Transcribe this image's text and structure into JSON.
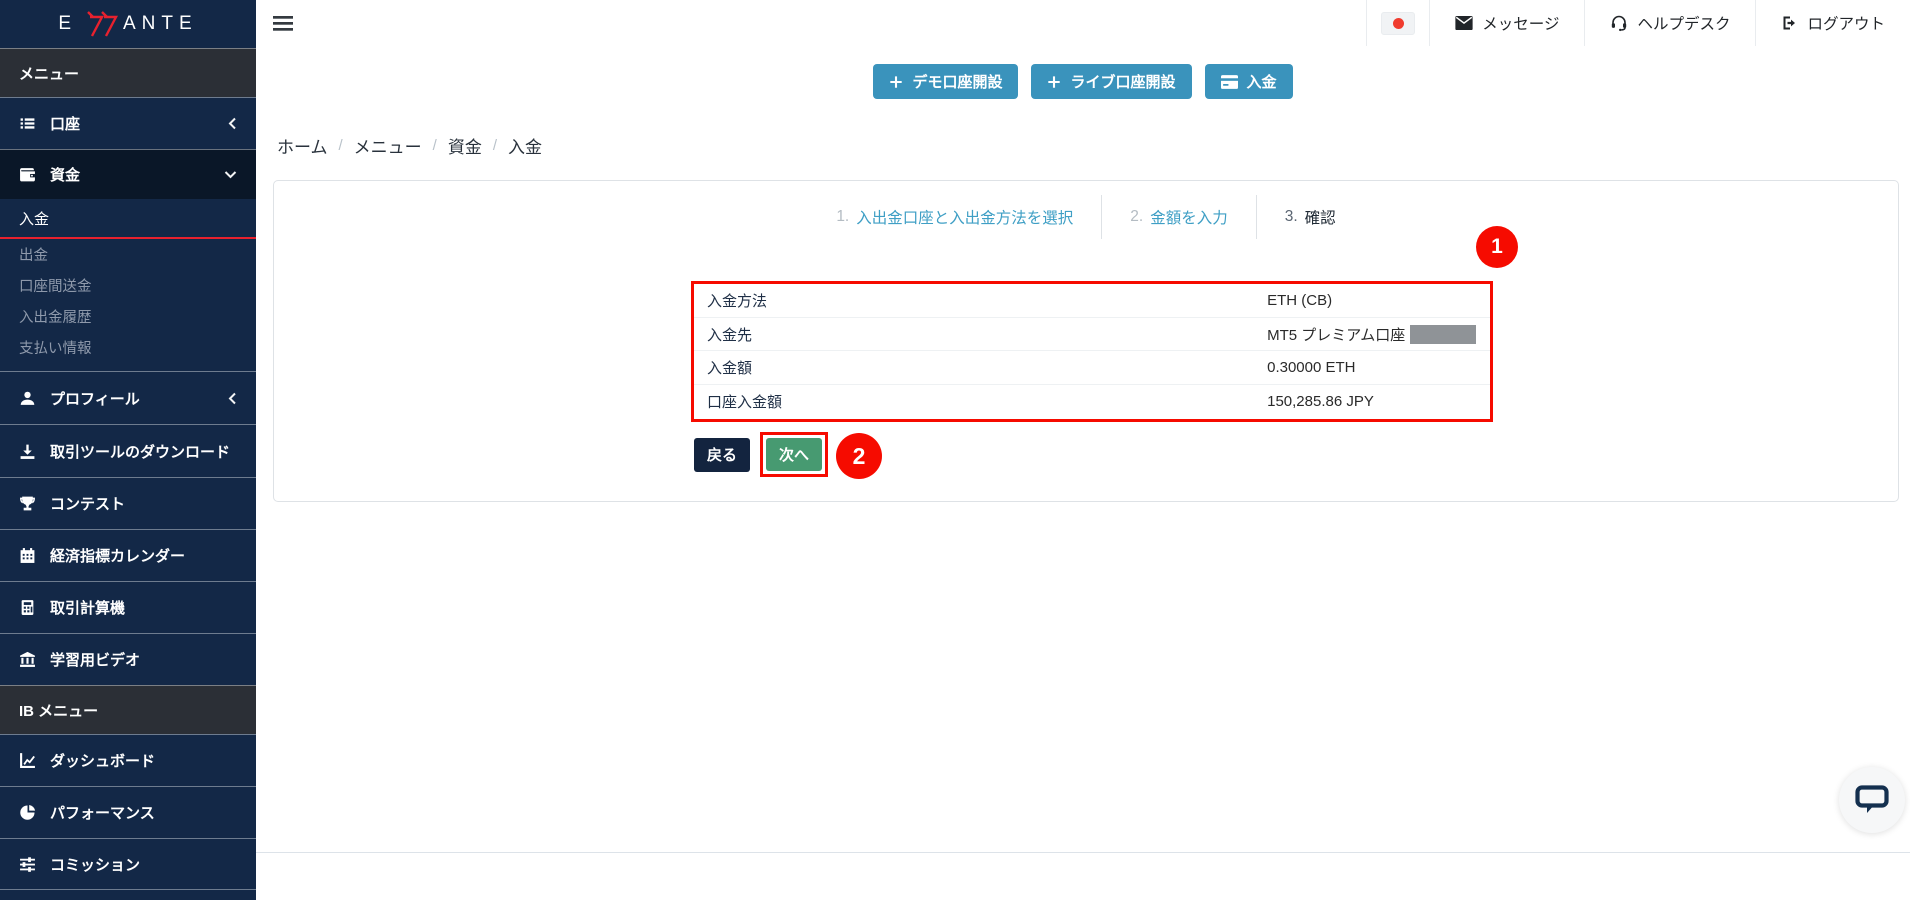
{
  "brand": {
    "logo_e": "E",
    "logo_tail": "ANTE"
  },
  "topbar": {
    "messages_label": "メッセージ",
    "helpdesk_label": "ヘルプデスク",
    "logout_label": "ログアウト"
  },
  "action_buttons": {
    "demo_label": "デモ口座開設",
    "live_label": "ライブ口座開設",
    "deposit_label": "入金"
  },
  "sidebar": {
    "section_menu_label": "メニュー",
    "section_ib_label": "IB メニュー",
    "items": {
      "accounts": "口座",
      "funds": "資金",
      "deposit": "入金",
      "withdraw": "出金",
      "transfer": "口座間送金",
      "history": "入出金履歴",
      "payment_info": "支払い情報",
      "profile": "プロフィール",
      "tools": "取引ツールのダウンロード",
      "contest": "コンテスト",
      "calendar": "経済指標カレンダー",
      "calculator": "取引計算機",
      "videos": "学習用ビデオ",
      "dashboard": "ダッシュボード",
      "performance": "パフォーマンス",
      "commission": "コミッション"
    }
  },
  "breadcrumb": {
    "separator": "/",
    "items": [
      "ホーム",
      "メニュー",
      "資金",
      "入金"
    ]
  },
  "wizard": {
    "steps": [
      {
        "num": "1.",
        "label": "入出金口座と入出金方法を選択"
      },
      {
        "num": "2.",
        "label": "金額を入力"
      },
      {
        "num": "3.",
        "label": "確認"
      }
    ]
  },
  "summary": {
    "rows": [
      {
        "label": "入金方法",
        "value": "ETH (CB)"
      },
      {
        "label": "入金先",
        "value": "MT5 プレミアム口座"
      },
      {
        "label": "入金額",
        "value": "0.30000 ETH"
      },
      {
        "label": "口座入金額",
        "value": "150,285.86 JPY"
      }
    ]
  },
  "form_buttons": {
    "back_label": "戻る",
    "next_label": "次へ"
  },
  "annotations": {
    "badge_1": "1",
    "badge_2": "2"
  },
  "colors": {
    "annotation_red": "#f60b00",
    "brand_navy": "#132847",
    "action_blue": "#3a93bc",
    "success_green": "#479a71",
    "step_link_blue": "#3f9fc5",
    "logo_red": "#e8212e",
    "active_underline_red": "#e8212e"
  }
}
